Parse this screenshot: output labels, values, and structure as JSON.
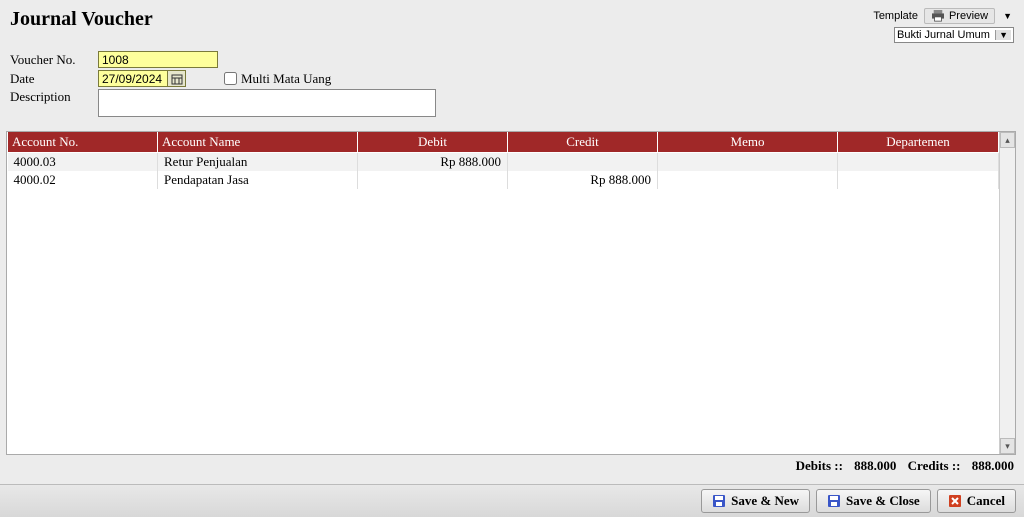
{
  "title": "Journal Voucher",
  "template_label": "Template",
  "preview_label": "Preview",
  "template_selected": "Bukti Jurnal Umum",
  "form": {
    "voucher_label": "Voucher No.",
    "voucher_value": "1008",
    "date_label": "Date",
    "date_value": "27/09/2024",
    "multi_label": "Multi Mata Uang",
    "desc_label": "Description",
    "desc_value": ""
  },
  "columns": {
    "acct": "Account No.",
    "name": "Account Name",
    "debit": "Debit",
    "credit": "Credit",
    "memo": "Memo",
    "dept": "Departemen"
  },
  "rows": [
    {
      "acct": "4000.03",
      "name": "Retur Penjualan",
      "debit": "Rp 888.000",
      "credit": "",
      "memo": "",
      "dept": ""
    },
    {
      "acct": "4000.02",
      "name": "Pendapatan Jasa",
      "debit": "",
      "credit": "Rp 888.000",
      "memo": "",
      "dept": ""
    }
  ],
  "totals": {
    "debits_label": "Debits ::",
    "debits_value": "888.000",
    "credits_label": "Credits ::",
    "credits_value": "888.000"
  },
  "buttons": {
    "save_new": "Save & New",
    "save_close": "Save & Close",
    "cancel": "Cancel"
  }
}
